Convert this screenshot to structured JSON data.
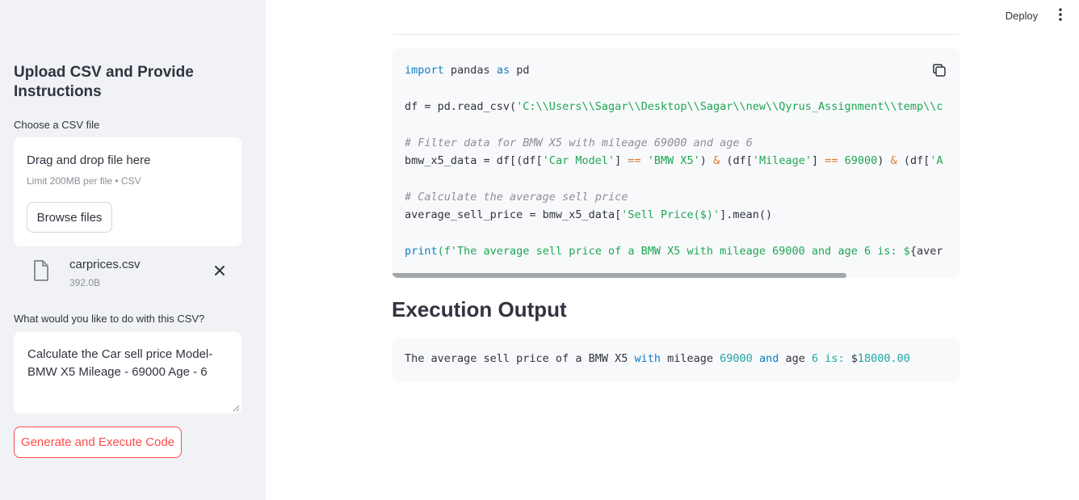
{
  "header": {
    "deploy_label": "Deploy",
    "menu_icon": "kebab-menu-icon"
  },
  "sidebar": {
    "title": "Upload CSV and Provide Instructions",
    "file_label": "Choose a CSV file",
    "dropzone": {
      "main": "Drag and drop file here",
      "sub": "Limit 200MB per file • CSV",
      "browse_label": "Browse files"
    },
    "uploaded_file": {
      "name": "carprices.csv",
      "size": "392.0B",
      "icon": "file-icon"
    },
    "instructions_label": "What would you like to do with this CSV?",
    "instructions_value": "Calculate the Car sell price Model- BMW X5 Mileage - 69000 Age - 6",
    "generate_label": "Generate and Execute Code"
  },
  "code": {
    "lines": [
      [
        {
          "t": "import",
          "c": "kw"
        },
        {
          "t": " pandas "
        },
        {
          "t": "as",
          "c": "kw"
        },
        {
          "t": " pd"
        }
      ],
      [],
      [
        {
          "t": "df = pd.read_csv("
        },
        {
          "t": "'C:\\\\Users\\\\Sagar\\\\Desktop\\\\Sagar\\\\new\\\\Qyrus_Assignment\\\\temp\\\\c",
          "c": "str"
        }
      ],
      [],
      [
        {
          "t": "# Filter data for BMW X5 with mileage 69000 and age 6",
          "c": "cmt"
        }
      ],
      [
        {
          "t": "bmw_x5_data = df[(df["
        },
        {
          "t": "'Car Model'",
          "c": "str"
        },
        {
          "t": "] "
        },
        {
          "t": "==",
          "c": "op"
        },
        {
          "t": " "
        },
        {
          "t": "'BMW X5'",
          "c": "str"
        },
        {
          "t": ") "
        },
        {
          "t": "&",
          "c": "op"
        },
        {
          "t": " (df["
        },
        {
          "t": "'Mileage'",
          "c": "str"
        },
        {
          "t": "] "
        },
        {
          "t": "==",
          "c": "op"
        },
        {
          "t": " "
        },
        {
          "t": "69000",
          "c": "num"
        },
        {
          "t": ") "
        },
        {
          "t": "&",
          "c": "op"
        },
        {
          "t": " (df["
        },
        {
          "t": "'A",
          "c": "str"
        }
      ],
      [],
      [
        {
          "t": "# Calculate the average sell price",
          "c": "cmt"
        }
      ],
      [
        {
          "t": "average_sell_price = bmw_x5_data["
        },
        {
          "t": "'Sell Price($)'",
          "c": "str"
        },
        {
          "t": "].mean()"
        }
      ],
      [],
      [
        {
          "t": "print",
          "c": "kw"
        },
        {
          "t": "(f",
          "c": "str"
        },
        {
          "t": "'The average sell price of a BMW X5 with mileage 69000 and age 6 is: $",
          "c": "str"
        },
        {
          "t": "{aver"
        }
      ]
    ],
    "copy_icon": "copy-icon",
    "scroll_fraction": 0.8
  },
  "execution": {
    "title": "Execution Output",
    "output": [
      {
        "t": "The average sell price of a BMW X5 "
      },
      {
        "t": "with",
        "c": "o-kw"
      },
      {
        "t": " mileage "
      },
      {
        "t": "69000",
        "c": "o-num"
      },
      {
        "t": " "
      },
      {
        "t": "and",
        "c": "o-kw"
      },
      {
        "t": " age "
      },
      {
        "t": "6",
        "c": "o-num"
      },
      {
        "t": " "
      },
      {
        "t": "is:",
        "c": "o-num"
      },
      {
        "t": " $"
      },
      {
        "t": "18000.00",
        "c": "o-num"
      }
    ]
  }
}
